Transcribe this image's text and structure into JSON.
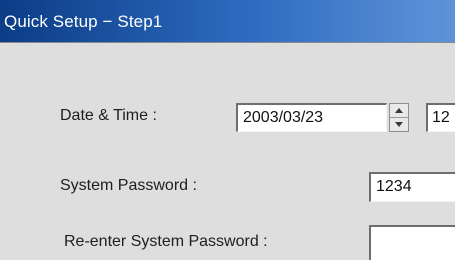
{
  "window": {
    "title": "Quick Setup − Step1"
  },
  "form": {
    "date_time": {
      "label": "Date & Time :",
      "date_value": "2003/03/23",
      "time_value": "12"
    },
    "system_password": {
      "label": "System Password :",
      "value": "1234"
    },
    "reenter_password": {
      "label": "Re-enter System Password :",
      "value": ""
    }
  },
  "colors": {
    "title_bar_start": "#0b3d86",
    "title_bar_end": "#5e93d8",
    "background": "#dedede"
  }
}
